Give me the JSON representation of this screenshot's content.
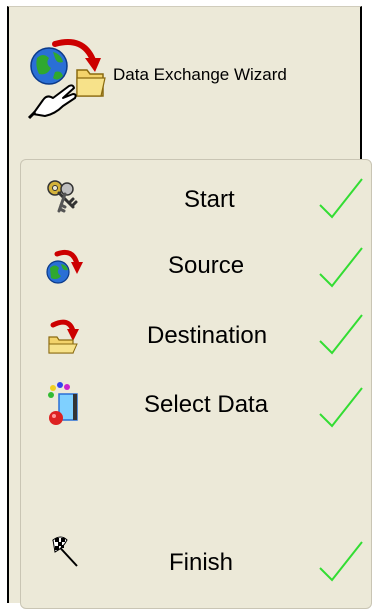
{
  "header": {
    "title": "Data Exchange Wizard",
    "icon": "globe-folder-hand-icon"
  },
  "steps": [
    {
      "label": "Start",
      "icon": "keys-icon",
      "completed": true
    },
    {
      "label": "Source",
      "icon": "globe-arrow-icon",
      "completed": true
    },
    {
      "label": "Destination",
      "icon": "folder-arrow-icon",
      "completed": true
    },
    {
      "label": "Select Data",
      "icon": "select-data-icon",
      "completed": true
    },
    {
      "label": "Finish",
      "icon": "checkered-flag-icon",
      "completed": true
    }
  ],
  "colors": {
    "panel_bg": "#ece9d8",
    "check_green": "#22dd22",
    "border": "#000000"
  }
}
